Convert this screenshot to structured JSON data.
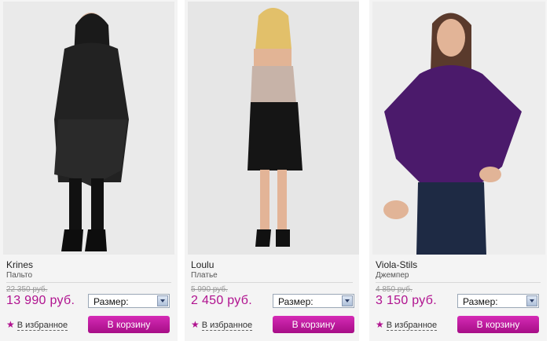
{
  "products": [
    {
      "brand": "Krines",
      "type": "Пальто",
      "old_price": "22 350 руб.",
      "price": "13 990 руб.",
      "size_label": "Размер:",
      "favorite_label": "В избранное",
      "cart_label": "В корзину"
    },
    {
      "brand": "Loulu",
      "type": "Платье",
      "old_price": "5 990 руб.",
      "price": "2 450 руб.",
      "size_label": "Размер:",
      "favorite_label": "В избранное",
      "cart_label": "В корзину"
    },
    {
      "brand": "Viola-Stils",
      "type": "Джемпер",
      "old_price": "4 850 руб.",
      "price": "3 150 руб.",
      "size_label": "Размер:",
      "favorite_label": "В избранное",
      "cart_label": "В корзину"
    }
  ],
  "colors": {
    "accent": "#b0128f",
    "card_bg": "#f4f4f4",
    "coat": "#1c1c1c",
    "dress_top": "#c9b7ad",
    "sweater": "#4b1a6b"
  },
  "icons": {
    "favorite": "star-icon",
    "select": "chevron-down-icon"
  }
}
